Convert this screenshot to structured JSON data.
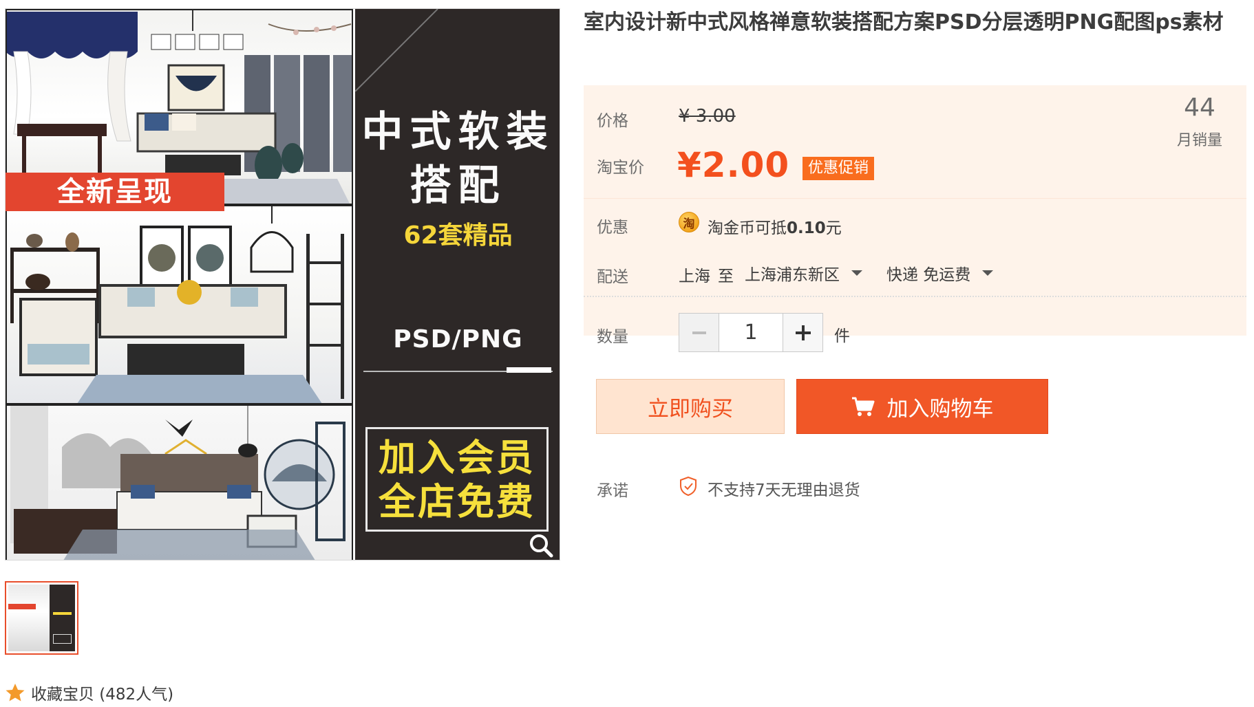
{
  "product": {
    "title": "室内设计新中式风格禅意软装搭配方案PSD分层透明PNG配图ps素材"
  },
  "image_text": {
    "ribbon": "全新呈现",
    "title_line1": "中式软装",
    "title_line2": "搭配",
    "sets": "62套精品",
    "format": "PSD/PNG",
    "member_line1": "加入会员",
    "member_line2": "全店免费"
  },
  "price": {
    "label": "价格",
    "original": "¥ 3.00",
    "taobao_label": "淘宝价",
    "current": "¥2.00",
    "promo_tag": "优惠促销"
  },
  "sales": {
    "count": "44",
    "label": "月销量"
  },
  "discount": {
    "label": "优惠",
    "coin_icon_text": "淘",
    "text_prefix": "淘金币可抵",
    "amount": "0.10",
    "unit": "元"
  },
  "delivery": {
    "label": "配送",
    "from": "上海",
    "to_word": "至",
    "destination": "上海浦东新区",
    "method": "快递 免运费"
  },
  "quantity": {
    "label": "数量",
    "value": "1",
    "unit": "件"
  },
  "actions": {
    "buy_now": "立即购买",
    "add_to_cart": "加入购物车"
  },
  "promise": {
    "label": "承诺",
    "text": "不支持7天无理由退货"
  },
  "favorite": {
    "text": "收藏宝贝 (482人气)"
  },
  "colors": {
    "accent": "#f3501e",
    "price_bg": "#fef3ea",
    "promo_tag": "#f96d1e",
    "cart_button": "#f15727",
    "buy_now_bg": "#ffe4d0"
  },
  "icons": [
    "search-zoom-icon",
    "chevron-down-icon",
    "minus-icon",
    "plus-icon",
    "cart-icon",
    "shield-check-icon",
    "star-icon",
    "taobao-coin-icon"
  ]
}
